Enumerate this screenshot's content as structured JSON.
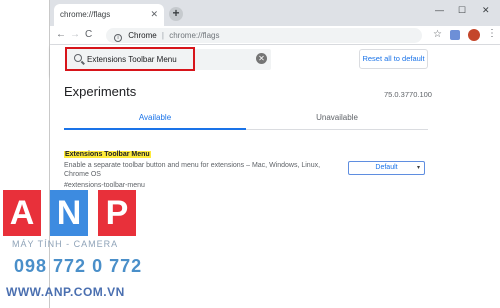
{
  "browser": {
    "tab_title": "chrome://flags",
    "tab_close": "✕",
    "new_tab": "+",
    "min": "—",
    "max": "☐",
    "close": "✕",
    "nav": {
      "back": "→",
      "forward": "→",
      "reload": "C",
      "home": "⌂"
    },
    "address": {
      "scheme_label": "Chrome",
      "separator": "|",
      "url": "chrome://flags"
    },
    "bookmark_star": "☆",
    "menu": "⋮"
  },
  "flags": {
    "search": {
      "value": "Extensions Toolbar Menu"
    },
    "reset_label": "Reset all to default",
    "page_title": "Experiments",
    "version": "75.0.3770.100",
    "tabs": [
      {
        "label": "Available"
      },
      {
        "label": "Unavailable"
      }
    ],
    "experiment": {
      "name": "Extensions Toolbar Menu",
      "description": "Enable a separate toolbar button and menu for extensions – Mac, Windows, Linux, Chrome OS",
      "link": "#extensions-toolbar-menu",
      "select_value": "Default",
      "select_caret": "▾"
    }
  },
  "watermark": {
    "letters": [
      "A",
      "N",
      "P"
    ],
    "tagline": "MÁY TÍNH - CAMERA",
    "phone": "098 772 0 772",
    "url": "WWW.ANP.COM.VN",
    "colors": {
      "red": "#e8303a",
      "blue": "#3d8be0"
    }
  }
}
